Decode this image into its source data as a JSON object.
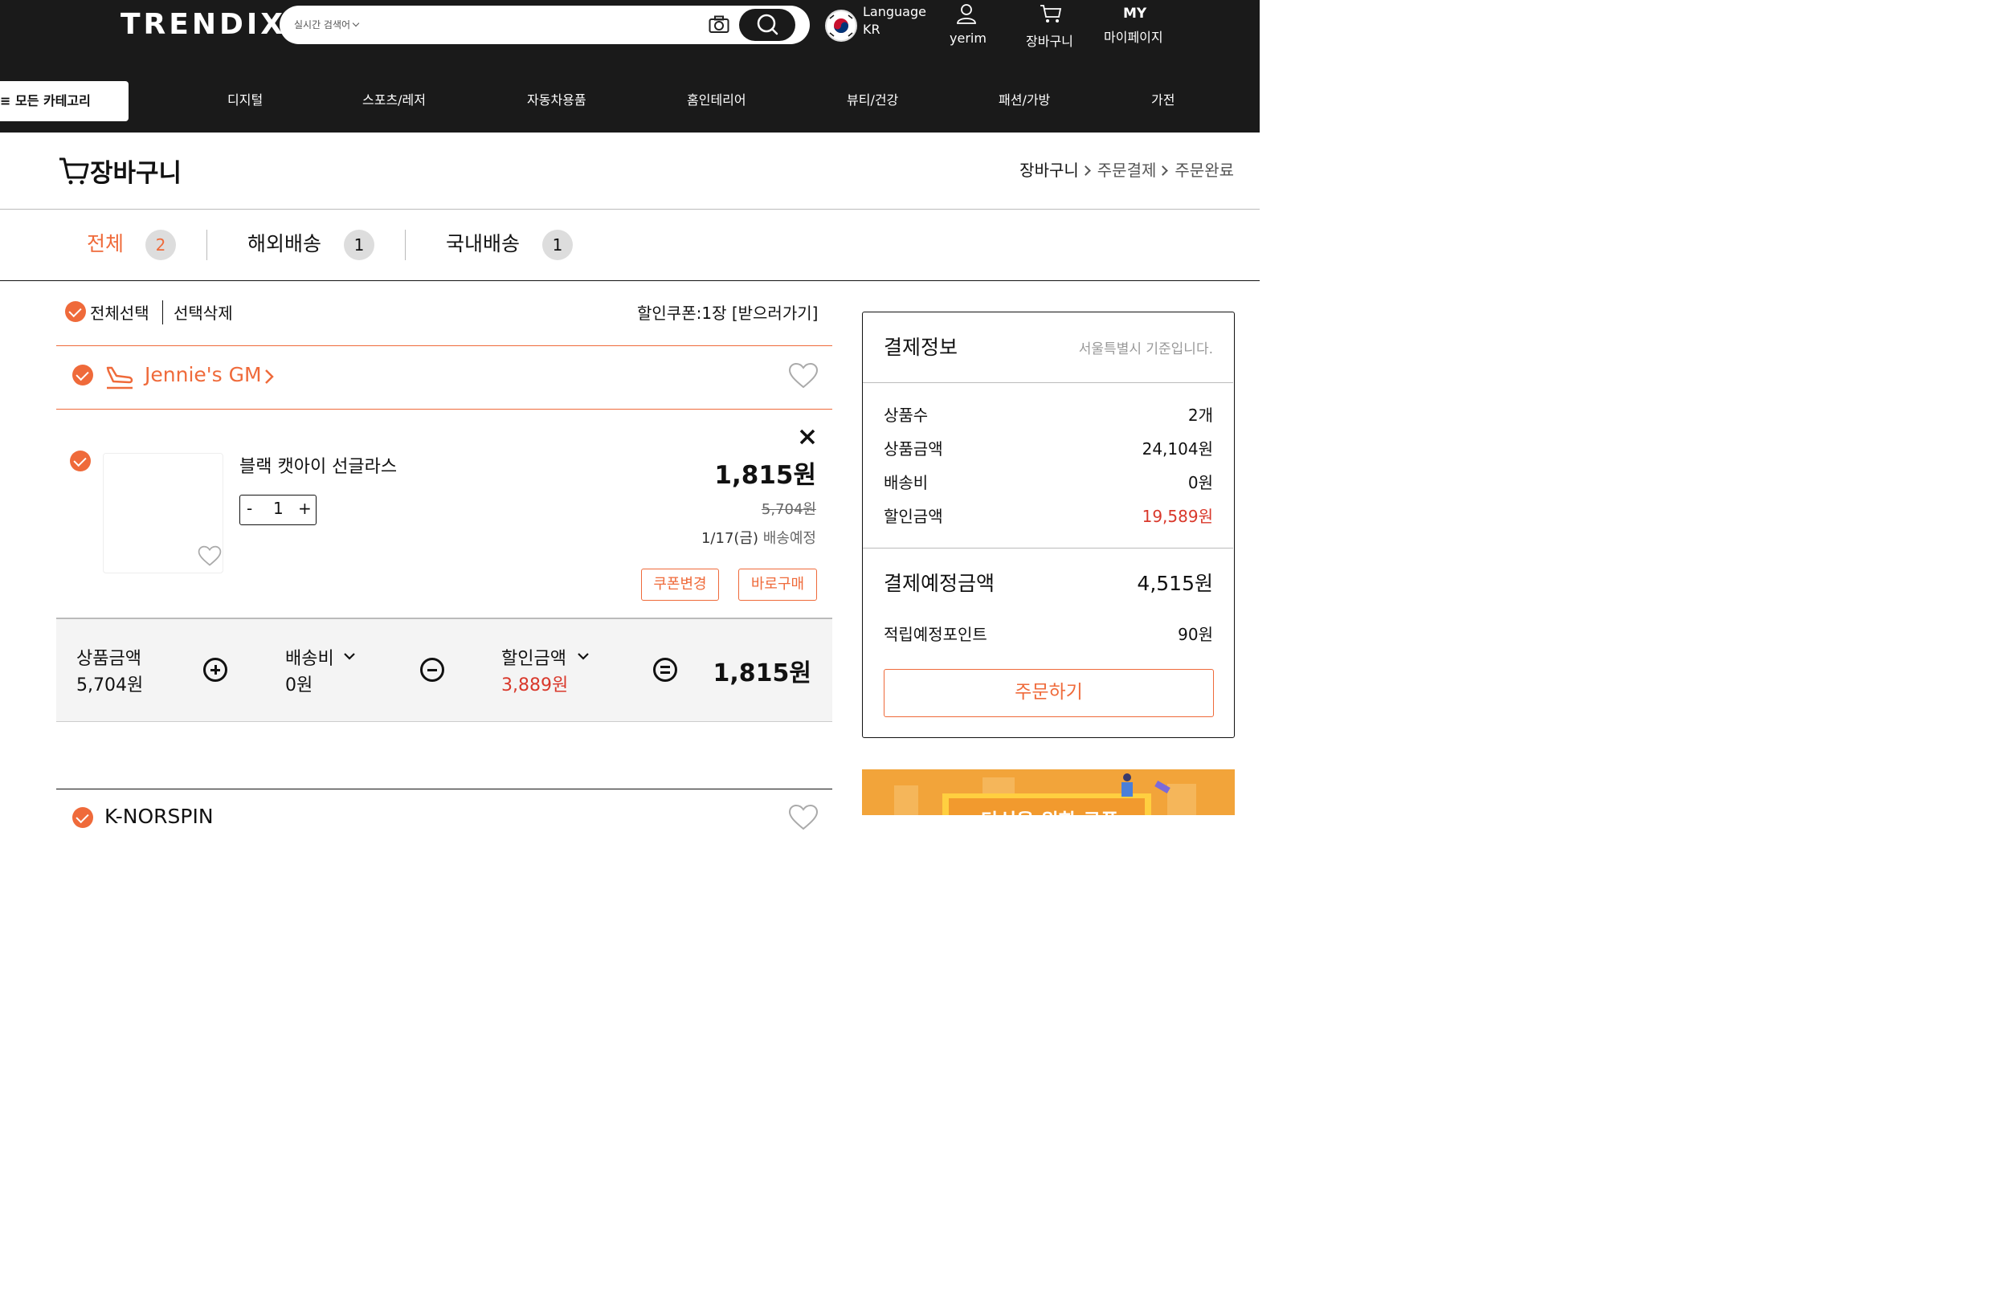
{
  "header": {
    "logo": "TRENDIX",
    "search_placeholder": "실시간 검색어",
    "language_label": "Language",
    "language_value": "KR",
    "user_label": "yerim",
    "cart_label": "장바구니",
    "my_label": "MY",
    "mypage_label": "마이페이지"
  },
  "nav": {
    "all_categories": "모든 카테고리",
    "items": [
      "디지털",
      "스포츠/레저",
      "자동차용품",
      "홈인테리어",
      "뷰티/건강",
      "패션/가방",
      "가전"
    ]
  },
  "page": {
    "title": "장바구니",
    "steps": [
      "장바구니",
      "주문결제",
      "주문완료"
    ]
  },
  "tabs": [
    {
      "label": "전체",
      "count": "2"
    },
    {
      "label": "해외배송",
      "count": "1"
    },
    {
      "label": "국내배송",
      "count": "1"
    }
  ],
  "actions": {
    "select_all": "전체선택",
    "delete_selected": "선택삭제",
    "coupon_info": "할인쿠폰:1장 [받으러가기]"
  },
  "seller": {
    "name": "Jennie's GM",
    "next_seller_partial": "K-NORSPIN"
  },
  "item": {
    "name": "블랙 캣아이 선글라스",
    "quantity": "1",
    "qty_minus": "-",
    "qty_plus": "+",
    "price": "1,815원",
    "original_price": "5,704원",
    "delivery_date": "1/17(금)",
    "delivery_label": "배송예정",
    "coupon_button": "쿠폰변경",
    "buy_now_button": "바로구매"
  },
  "summary": {
    "product_label": "상품금액",
    "product_value": "5,704원",
    "shipping_label": "배송비",
    "shipping_value": "0원",
    "discount_label": "할인금액",
    "discount_value": "3,889원",
    "total_value": "1,815원"
  },
  "payment": {
    "title": "결제정보",
    "region_note": "서울특별시 기준입니다.",
    "rows": [
      {
        "label": "상품수",
        "value": "2개"
      },
      {
        "label": "상품금액",
        "value": "24,104원"
      },
      {
        "label": "배송비",
        "value": "0원"
      },
      {
        "label": "할인금액",
        "value": "19,589원"
      }
    ],
    "expected_label": "결제예정금액",
    "expected_value": "4,515원",
    "points_label": "적립예정포인트",
    "points_value": "90원",
    "order_button": "주문하기"
  },
  "banner": {
    "text_partial": "당신을 위한 쿠폰"
  },
  "colors": {
    "accent": "#ef6a3a",
    "discount_red": "#d9382b",
    "header_bg": "#1a1a1a"
  }
}
